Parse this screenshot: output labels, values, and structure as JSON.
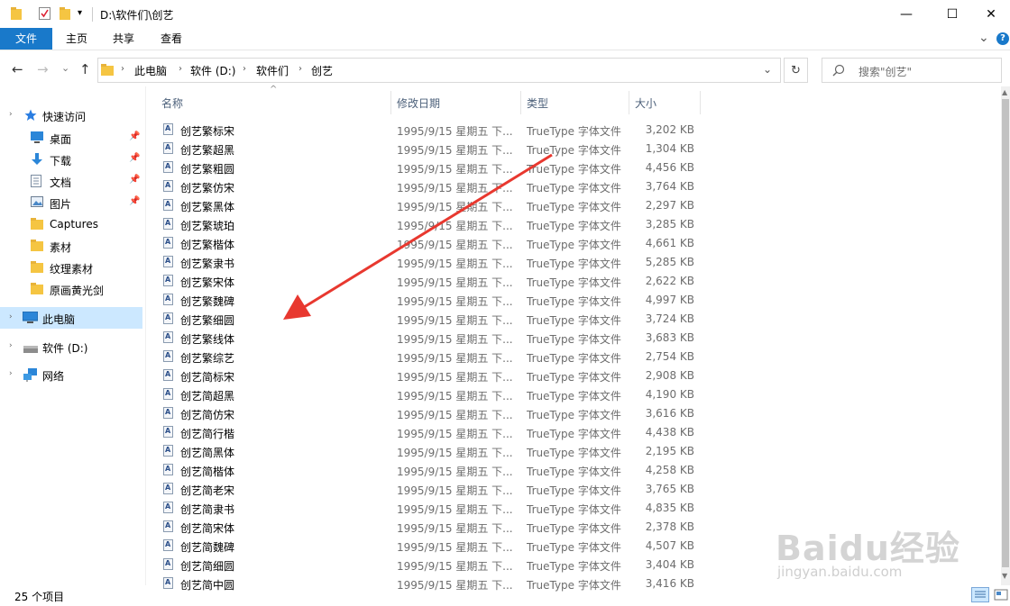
{
  "window": {
    "title": "D:\\软件们\\创艺",
    "minimize_glyph": "—",
    "maximize_glyph": "☐",
    "close_glyph": "✕"
  },
  "ribbon": {
    "tabs": [
      "文件",
      "主页",
      "共享",
      "查看"
    ],
    "expand_glyph": "⌄",
    "help_glyph": "?"
  },
  "address": {
    "back_glyph": "←",
    "forward_glyph": "→",
    "dropdown_glyph": "⌄",
    "up_glyph": "↑",
    "crumbs": [
      "此电脑",
      "软件 (D:)",
      "软件们",
      "创艺"
    ],
    "sep_glyph": "›",
    "history_glyph": "⌄",
    "refresh_glyph": "↻",
    "search_placeholder": "搜索\"创艺\""
  },
  "nav": {
    "quick_access": "快速访问",
    "items": [
      {
        "label": "桌面",
        "icon": "desktop-icon",
        "pinned": true
      },
      {
        "label": "下载",
        "icon": "download-icon",
        "pinned": true
      },
      {
        "label": "文档",
        "icon": "document-icon",
        "pinned": true
      },
      {
        "label": "图片",
        "icon": "picture-icon",
        "pinned": true
      },
      {
        "label": "Captures",
        "icon": "folder-icon",
        "pinned": false
      },
      {
        "label": "素材",
        "icon": "folder-icon",
        "pinned": false
      },
      {
        "label": "纹理素材",
        "icon": "folder-icon",
        "pinned": false
      },
      {
        "label": "原画黄光剑",
        "icon": "folder-icon",
        "pinned": false
      }
    ],
    "this_pc": "此电脑",
    "drive": "软件 (D:)",
    "network": "网络"
  },
  "columns": {
    "name": "名称",
    "date": "修改日期",
    "type": "类型",
    "size": "大小",
    "sort_glyph": "^"
  },
  "files": [
    {
      "name": "创艺繁标宋",
      "date": "1995/9/15 星期五 下...",
      "type": "TrueType 字体文件",
      "size": "3,202 KB"
    },
    {
      "name": "创艺繁超黑",
      "date": "1995/9/15 星期五 下...",
      "type": "TrueType 字体文件",
      "size": "1,304 KB"
    },
    {
      "name": "创艺繁粗圆",
      "date": "1995/9/15 星期五 下...",
      "type": "TrueType 字体文件",
      "size": "4,456 KB"
    },
    {
      "name": "创艺繁仿宋",
      "date": "1995/9/15 星期五 下...",
      "type": "TrueType 字体文件",
      "size": "3,764 KB"
    },
    {
      "name": "创艺繁黑体",
      "date": "1995/9/15 星期五 下...",
      "type": "TrueType 字体文件",
      "size": "2,297 KB"
    },
    {
      "name": "创艺繁琥珀",
      "date": "1995/9/15 星期五 下...",
      "type": "TrueType 字体文件",
      "size": "3,285 KB"
    },
    {
      "name": "创艺繁楷体",
      "date": "1995/9/15 星期五 下...",
      "type": "TrueType 字体文件",
      "size": "4,661 KB"
    },
    {
      "name": "创艺繁隶书",
      "date": "1995/9/15 星期五 下...",
      "type": "TrueType 字体文件",
      "size": "5,285 KB"
    },
    {
      "name": "创艺繁宋体",
      "date": "1995/9/15 星期五 下...",
      "type": "TrueType 字体文件",
      "size": "2,622 KB"
    },
    {
      "name": "创艺繁魏碑",
      "date": "1995/9/15 星期五 下...",
      "type": "TrueType 字体文件",
      "size": "4,997 KB"
    },
    {
      "name": "创艺繁细圆",
      "date": "1995/9/15 星期五 下...",
      "type": "TrueType 字体文件",
      "size": "3,724 KB"
    },
    {
      "name": "创艺繁线体",
      "date": "1995/9/15 星期五 下...",
      "type": "TrueType 字体文件",
      "size": "3,683 KB"
    },
    {
      "name": "创艺繁综艺",
      "date": "1995/9/15 星期五 下...",
      "type": "TrueType 字体文件",
      "size": "2,754 KB"
    },
    {
      "name": "创艺简标宋",
      "date": "1995/9/15 星期五 下...",
      "type": "TrueType 字体文件",
      "size": "2,908 KB"
    },
    {
      "name": "创艺简超黑",
      "date": "1995/9/15 星期五 下...",
      "type": "TrueType 字体文件",
      "size": "4,190 KB"
    },
    {
      "name": "创艺简仿宋",
      "date": "1995/9/15 星期五 下...",
      "type": "TrueType 字体文件",
      "size": "3,616 KB"
    },
    {
      "name": "创艺简行楷",
      "date": "1995/9/15 星期五 下...",
      "type": "TrueType 字体文件",
      "size": "4,438 KB"
    },
    {
      "name": "创艺简黑体",
      "date": "1995/9/15 星期五 下...",
      "type": "TrueType 字体文件",
      "size": "2,195 KB"
    },
    {
      "name": "创艺简楷体",
      "date": "1995/9/15 星期五 下...",
      "type": "TrueType 字体文件",
      "size": "4,258 KB"
    },
    {
      "name": "创艺简老宋",
      "date": "1995/9/15 星期五 下...",
      "type": "TrueType 字体文件",
      "size": "3,765 KB"
    },
    {
      "name": "创艺简隶书",
      "date": "1995/9/15 星期五 下...",
      "type": "TrueType 字体文件",
      "size": "4,835 KB"
    },
    {
      "name": "创艺简宋体",
      "date": "1995/9/15 星期五 下...",
      "type": "TrueType 字体文件",
      "size": "2,378 KB"
    },
    {
      "name": "创艺简魏碑",
      "date": "1995/9/15 星期五 下...",
      "type": "TrueType 字体文件",
      "size": "4,507 KB"
    },
    {
      "name": "创艺简细圆",
      "date": "1995/9/15 星期五 下...",
      "type": "TrueType 字体文件",
      "size": "3,404 KB"
    },
    {
      "name": "创艺简中圆",
      "date": "1995/9/15 星期五 下...",
      "type": "TrueType 字体文件",
      "size": "3,416 KB"
    }
  ],
  "status": {
    "item_count": "25 个项目"
  },
  "watermark": {
    "text": "Baidu经验",
    "url": "jingyan.baidu.com"
  },
  "colors": {
    "accent": "#1979ca",
    "selected_nav": "#cce8ff",
    "annotation_arrow": "#e8382f"
  }
}
